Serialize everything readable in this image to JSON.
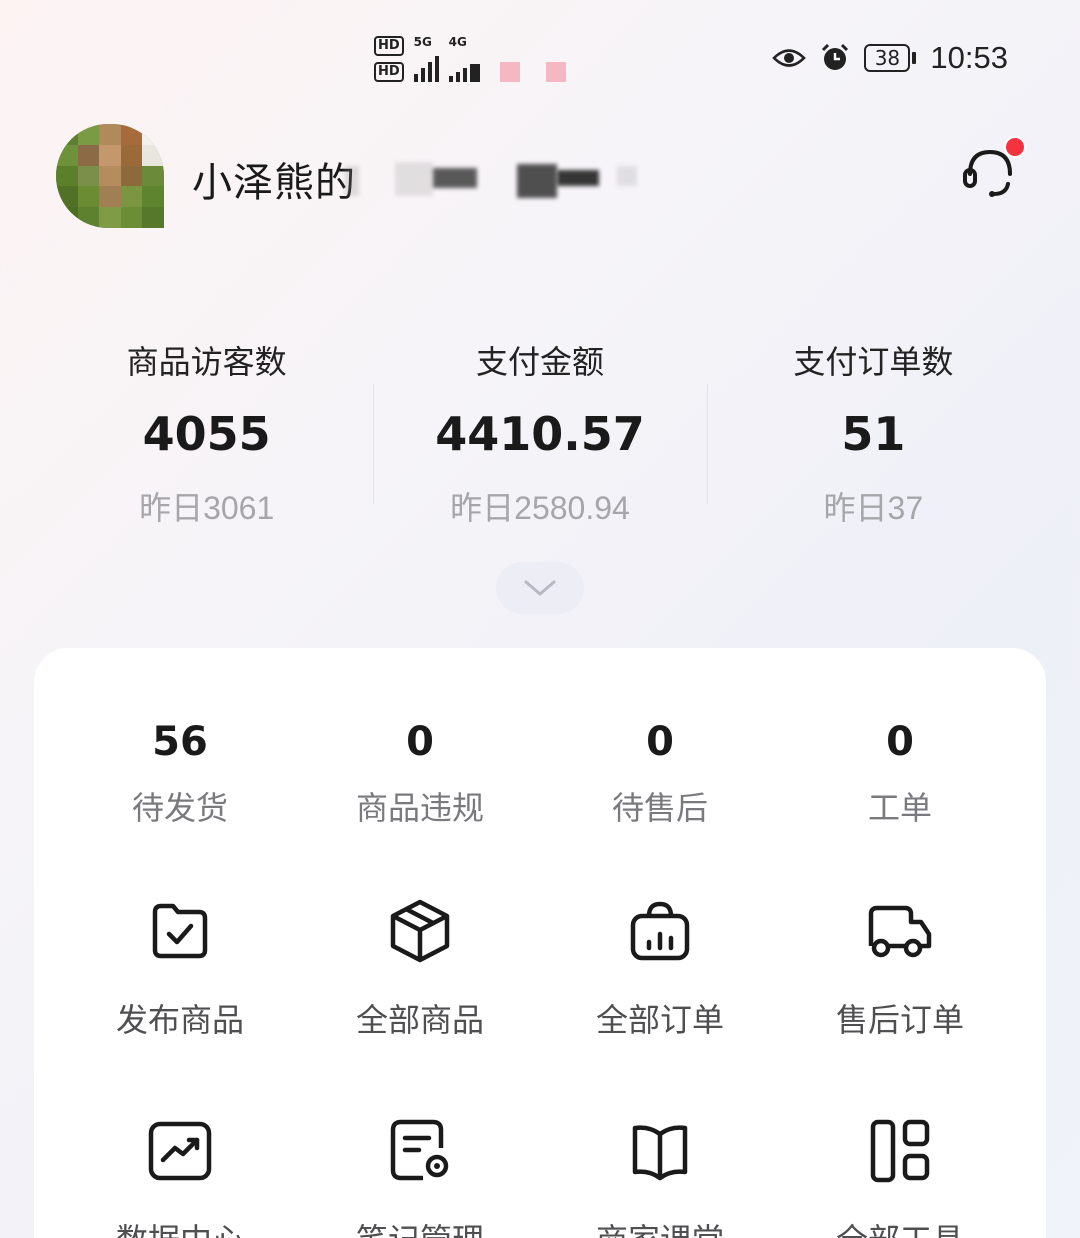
{
  "status_bar": {
    "hd1": "HD",
    "hd2": "HD",
    "net1": "5G",
    "net2": "4G",
    "battery": "38",
    "time": "10:53"
  },
  "header": {
    "shop_name": "小泽熊的"
  },
  "stats": [
    {
      "label": "商品访客数",
      "value": "4055",
      "prev": "昨日3061"
    },
    {
      "label": "支付金额",
      "value": "4410.57",
      "prev": "昨日2580.94"
    },
    {
      "label": "支付订单数",
      "value": "51",
      "prev": "昨日37"
    }
  ],
  "counters": [
    {
      "value": "56",
      "label": "待发货"
    },
    {
      "value": "0",
      "label": "商品违规"
    },
    {
      "value": "0",
      "label": "待售后"
    },
    {
      "value": "0",
      "label": "工单"
    }
  ],
  "tools": [
    {
      "label": "发布商品",
      "icon": "folder-check-icon"
    },
    {
      "label": "全部商品",
      "icon": "box-icon"
    },
    {
      "label": "全部订单",
      "icon": "order-bag-icon"
    },
    {
      "label": "售后订单",
      "icon": "truck-icon"
    },
    {
      "label": "数据中心",
      "icon": "trend-chart-icon"
    },
    {
      "label": "笔记管理",
      "icon": "note-settings-icon"
    },
    {
      "label": "商家课堂",
      "icon": "book-icon"
    },
    {
      "label": "全部工具",
      "icon": "grid-apps-icon"
    }
  ],
  "colors": {
    "notification_dot": "#f5333f",
    "muted_text": "#a6a6aa"
  }
}
